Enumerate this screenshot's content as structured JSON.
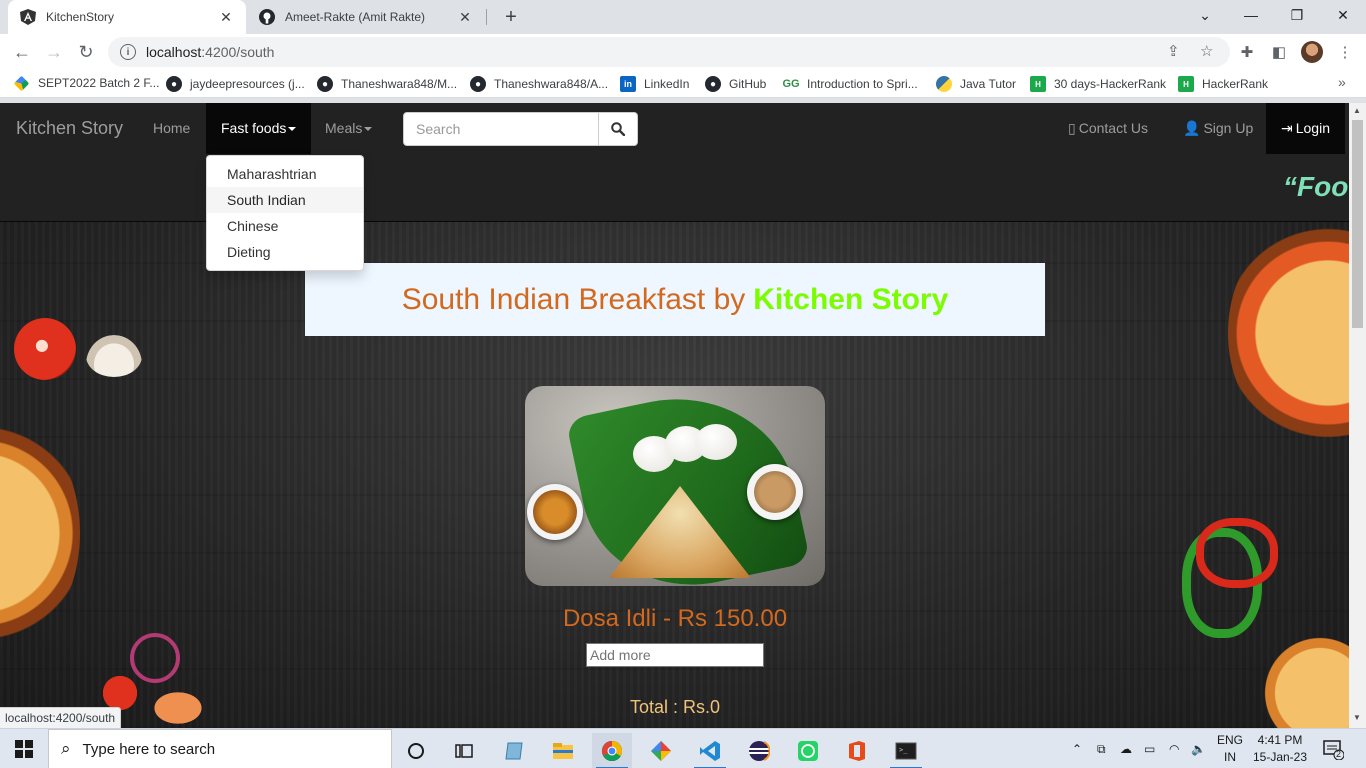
{
  "browser": {
    "tabs": [
      {
        "title": "KitchenStory",
        "active": true,
        "favicon": "angular-icon"
      },
      {
        "title": "Ameet-Rakte (Amit Rakte)",
        "active": false,
        "favicon": "github-icon"
      }
    ],
    "url_host": "localhost",
    "url_path": ":4200/south",
    "bookmarks": [
      {
        "label": "SEPT2022 Batch 2 F...",
        "icon": "drive-icon"
      },
      {
        "label": "jaydeepresources (j...",
        "icon": "github-icon"
      },
      {
        "label": "Thaneshwara848/M...",
        "icon": "github-icon"
      },
      {
        "label": "Thaneshwara848/A...",
        "icon": "github-icon"
      },
      {
        "label": "LinkedIn",
        "icon": "linkedin-icon"
      },
      {
        "label": "GitHub",
        "icon": "github-icon"
      },
      {
        "label": "Introduction to Spri...",
        "icon": "geeksforgeeks-icon"
      },
      {
        "label": "Java Tutor",
        "icon": "python-icon"
      },
      {
        "label": "30 days-HackerRank",
        "icon": "hackerrank-icon"
      },
      {
        "label": "HackerRank",
        "icon": "hackerrank-icon"
      }
    ],
    "status_url": "localhost:4200/south"
  },
  "navbar": {
    "brand": "Kitchen Story",
    "home": "Home",
    "fast_foods": "Fast foods",
    "meals": "Meals",
    "search_placeholder": "Search",
    "contact": "Contact Us",
    "signup": "Sign Up",
    "login": "Login",
    "marquee": "“Food"
  },
  "dropdown": {
    "items": [
      "Maharashtrian",
      "South Indian",
      "Chinese",
      "Dieting"
    ],
    "hovered": "South Indian"
  },
  "banner": {
    "prefix": "South Indian Breakfast by",
    "brand": "Kitchen Story"
  },
  "product": {
    "name": "Dosa Idli - Rs 150.00",
    "quantity_placeholder": "Add more",
    "total": "Total : Rs.0"
  },
  "taskbar": {
    "search_placeholder": "Type here to search",
    "lang_top": "ENG",
    "lang_bottom": "IN",
    "time": "4:41 PM",
    "date": "15-Jan-23",
    "notification_count": "2"
  },
  "colors": {
    "banner_text": "#d2691e",
    "banner_brand": "#7cfc00",
    "navbar_bg": "#222222",
    "total_text": "#f0c27a"
  }
}
